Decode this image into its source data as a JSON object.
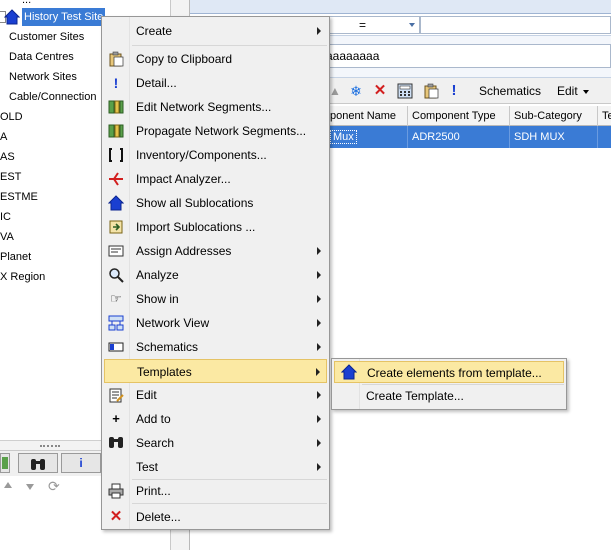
{
  "tree": {
    "top_partial": "...",
    "selected": "History Test Site",
    "items": [
      "Customer Sites",
      "Data Centres",
      "Network Sites",
      "Cable/Connection",
      "OLD",
      "A",
      "AS",
      "EST",
      "ESTME",
      "IC",
      "VA",
      "Planet",
      "X Region"
    ]
  },
  "filter": {
    "operator": "="
  },
  "value_field": {
    "value": "aaaaaaaa"
  },
  "toolbar": {
    "schematics_label": "Schematics",
    "edit_label": "Edit"
  },
  "grid": {
    "headers": [
      "ponent Name",
      "Component Type",
      "Sub-Category",
      "Te"
    ],
    "row": [
      "Mux",
      "ADR2500",
      "SDH MUX",
      ""
    ]
  },
  "context_menu": {
    "items": [
      {
        "label": "Create",
        "submenu": true
      },
      {
        "label": "Copy to Clipboard"
      },
      {
        "label": "Detail..."
      },
      {
        "label": "Edit Network Segments..."
      },
      {
        "label": "Propagate Network Segments..."
      },
      {
        "label": "Inventory/Components..."
      },
      {
        "label": "Impact Analyzer..."
      },
      {
        "label": "Show all Sublocations"
      },
      {
        "label": "Import Sublocations ..."
      },
      {
        "label": "Assign Addresses",
        "submenu": true
      },
      {
        "label": "Analyze",
        "submenu": true
      },
      {
        "label": "Show in",
        "submenu": true
      },
      {
        "label": "Network View",
        "submenu": true
      },
      {
        "label": "Schematics",
        "submenu": true
      },
      {
        "label": "Templates",
        "submenu": true
      },
      {
        "label": "Edit",
        "submenu": true
      },
      {
        "label": "Add to",
        "submenu": true
      },
      {
        "label": "Search",
        "submenu": true
      },
      {
        "label": "Test",
        "submenu": true
      },
      {
        "label": "Print..."
      },
      {
        "label": "Delete..."
      }
    ]
  },
  "templates_submenu": {
    "items": [
      {
        "label": "Create elements from template..."
      },
      {
        "label": "Create Template..."
      }
    ]
  },
  "colors": {
    "selection": "#3a7bd5",
    "menu_highlight": "#fbe9a3",
    "delete_red": "#d21f1f"
  }
}
